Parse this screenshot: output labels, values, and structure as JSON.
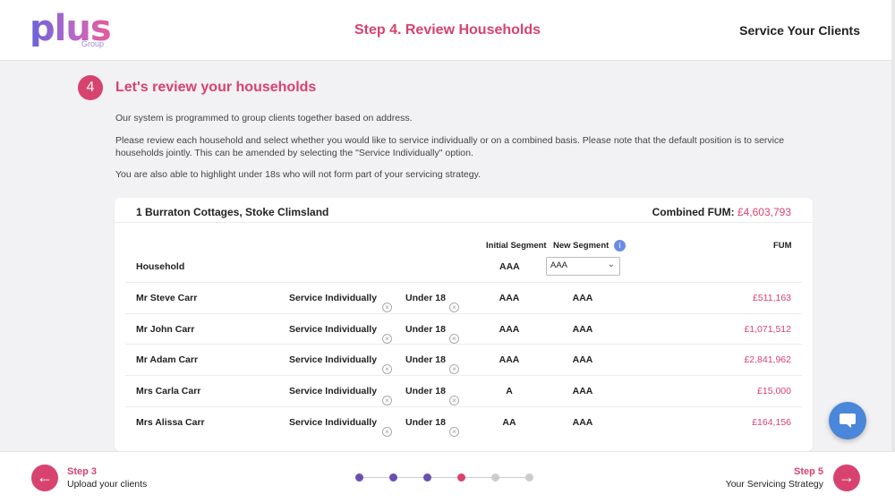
{
  "header": {
    "logo_text": "plus",
    "logo_sub": "Group",
    "step_title": "Step 4. Review Households",
    "right_title": "Service Your Clients"
  },
  "intro": {
    "step_number": "4",
    "title": "Let's review your households",
    "p1": "Our system is programmed to group clients together based on address.",
    "p2": "Please review each household and select whether you would like to service individually or on a combined basis. Please note that the default position is to service households jointly. This can be amended by selecting the \"Service Individually\" option.",
    "p3": "You are also able to highlight under 18s who will not form part of your servicing strategy."
  },
  "card": {
    "address": "1 Burraton Cottages, Stoke Climsland",
    "combined_label": "Combined FUM:",
    "combined_value": "£4,603,793",
    "columns": {
      "initial_segment": "Initial Segment",
      "new_segment": "New Segment",
      "fum": "FUM",
      "household": "Household"
    },
    "household_initial": "AAA",
    "household_new_selected": "AAA",
    "service_label": "Service Individually",
    "under18_label": "Under 18",
    "rows": [
      {
        "name": "Mr Steve Carr",
        "initial": "AAA",
        "new": "AAA",
        "fum": "£511,163"
      },
      {
        "name": "Mr John Carr",
        "initial": "AAA",
        "new": "AAA",
        "fum": "£1,071,512"
      },
      {
        "name": "Mr Adam Carr",
        "initial": "AAA",
        "new": "AAA",
        "fum": "£2,841,962"
      },
      {
        "name": "Mrs Carla Carr",
        "initial": "A",
        "new": "AAA",
        "fum": "£15,000"
      },
      {
        "name": "Mrs Alissa Carr",
        "initial": "AA",
        "new": "AAA",
        "fum": "£164,156"
      }
    ]
  },
  "footer": {
    "prev_step": "Step 3",
    "prev_label": "Upload your clients",
    "next_step": "Step 5",
    "next_label": "Your Servicing Strategy",
    "progress": {
      "total_steps": 6,
      "current_step": 4
    },
    "colors": {
      "done": "#6a4fb0",
      "current": "#d8426f",
      "todo": "#cccccc"
    }
  },
  "icons": {
    "prev": "arrow-left-icon",
    "next": "arrow-right-icon",
    "chat": "chat-bubble-icon",
    "info": "info-icon",
    "remove": "close-circle-icon"
  }
}
